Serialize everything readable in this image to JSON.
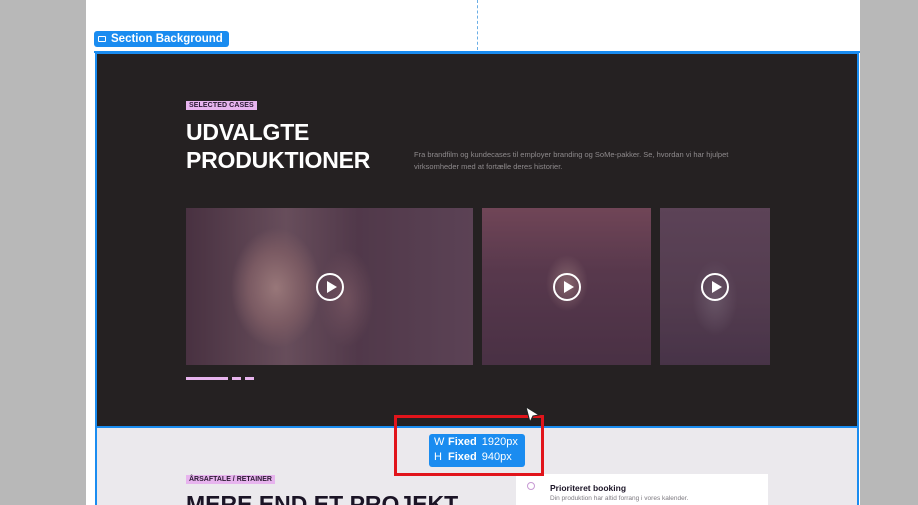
{
  "editor": {
    "section_tag_label": "Section Background",
    "dimensions": {
      "width_key": "W",
      "width_mode": "Fixed",
      "width_value": "1920px",
      "height_key": "H",
      "height_mode": "Fixed",
      "height_value": "940px"
    }
  },
  "cases_section": {
    "eyebrow": "SELECTED CASES",
    "title_line1": "UDVALGTE",
    "title_line2": "PRODUKTIONER",
    "lead": "Fra brandfilm og kundecases til employer branding og SoMe-pakker. Se, hvordan vi har hjulpet virksomheder med at fortælle deres historier.",
    "videos": [
      "play-icon",
      "play-icon",
      "play-icon"
    ],
    "carousel_pages": 3,
    "carousel_active": 1
  },
  "retainer_section": {
    "eyebrow": "ÅRSAFTALE / RETAINER",
    "title": "MERE END ET PROJEKT",
    "feature_title": "Prioriteret booking",
    "feature_text": "Din produktion har altid forrang i vores kalender."
  },
  "colors": {
    "accent": "#1a8cf0",
    "eyebrow": "#e7b4ee",
    "dark_bg": "#252122",
    "highlight": "#e1141b"
  }
}
